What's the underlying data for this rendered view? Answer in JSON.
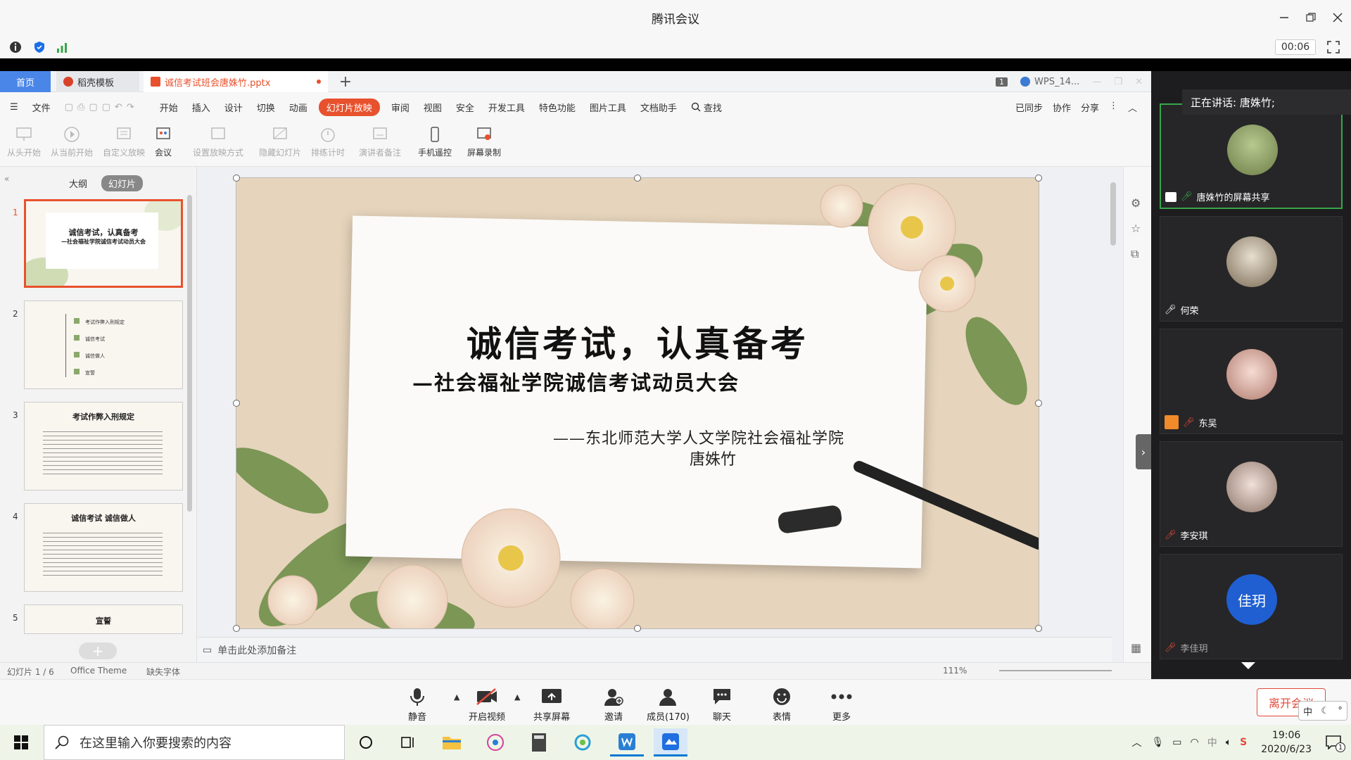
{
  "meeting": {
    "title": "腾讯会议",
    "timer": "00:06",
    "speaking_label": "正在讲话: 唐姝竹;"
  },
  "wps": {
    "tabs": {
      "home": "首页",
      "template": "稻壳模板",
      "file": "诚信考试班会唐姝竹.pptx",
      "count": "1",
      "wps_window": "WPS_14..."
    },
    "menu": [
      "文件",
      "开始",
      "插入",
      "设计",
      "切换",
      "动画",
      "幻灯片放映",
      "审阅",
      "视图",
      "安全",
      "开发工具",
      "特色功能",
      "图片工具",
      "文档助手",
      "查找"
    ],
    "menu_active": "幻灯片放映",
    "menu_right": [
      "已同步",
      "协作",
      "分享"
    ],
    "ribbon": [
      "从头开始",
      "从当前开始",
      "自定义放映",
      "会议",
      "设置放映方式",
      "隐藏幻灯片",
      "排练计时",
      "演讲者备注",
      "手机遥控",
      "屏幕录制"
    ],
    "panel_tabs": [
      "大纲",
      "幻灯片"
    ],
    "thumbnails": [
      {
        "num": "1",
        "title": "诚信考试，认真备考",
        "sub": "—社会福祉学院诚信考试动员大会"
      },
      {
        "num": "2",
        "items": [
          "考试作弊入刑规定",
          "诚信考试",
          "诚信做人",
          "宣誓"
        ]
      },
      {
        "num": "3",
        "title": "考试作弊入刑规定"
      },
      {
        "num": "4",
        "title": "诚信考试 诚信做人"
      },
      {
        "num": "5",
        "title": "宣誓"
      }
    ],
    "slide": {
      "title": "诚信考试，认真备考",
      "subtitle": "—社会福祉学院诚信考试动员大会",
      "org": "——东北师范大学人文学院社会福祉学院",
      "author": "唐姝竹"
    },
    "notes_placeholder": "单击此处添加备注",
    "status": {
      "slide_pos": "幻灯片 1 / 6",
      "theme": "Office Theme",
      "font_warn": "缺失字体",
      "zoom": "111%"
    }
  },
  "participants": [
    {
      "name": "唐姝竹的屏幕共享",
      "active": true,
      "avatar": "photo-field"
    },
    {
      "name": "何荣",
      "active": false,
      "avatar": "photo-boat"
    },
    {
      "name": "东吴",
      "active": false,
      "avatar": "photo-girl"
    },
    {
      "name": "李安琪",
      "active": false,
      "avatar": "photo-cat"
    },
    {
      "name": "李佳玥",
      "active": false,
      "avatar_text": "佳玥"
    }
  ],
  "meeting_toolbar": {
    "mute": "静音",
    "video": "开启视频",
    "share": "共享屏幕",
    "invite": "邀请",
    "members": "成员(170)",
    "chat": "聊天",
    "emoji": "表情",
    "more": "更多",
    "leave": "离开会议"
  },
  "ime": "中",
  "taskbar": {
    "search_placeholder": "在这里输入你要搜索的内容",
    "time": "19:06",
    "date": "2020/6/23",
    "ime": "中",
    "notif_count": "1"
  },
  "colors": {
    "wps_accent": "#e8512d",
    "meeting_green": "#37a64a",
    "home_tab": "#4a86e8",
    "leave_red": "#e24a3b"
  }
}
